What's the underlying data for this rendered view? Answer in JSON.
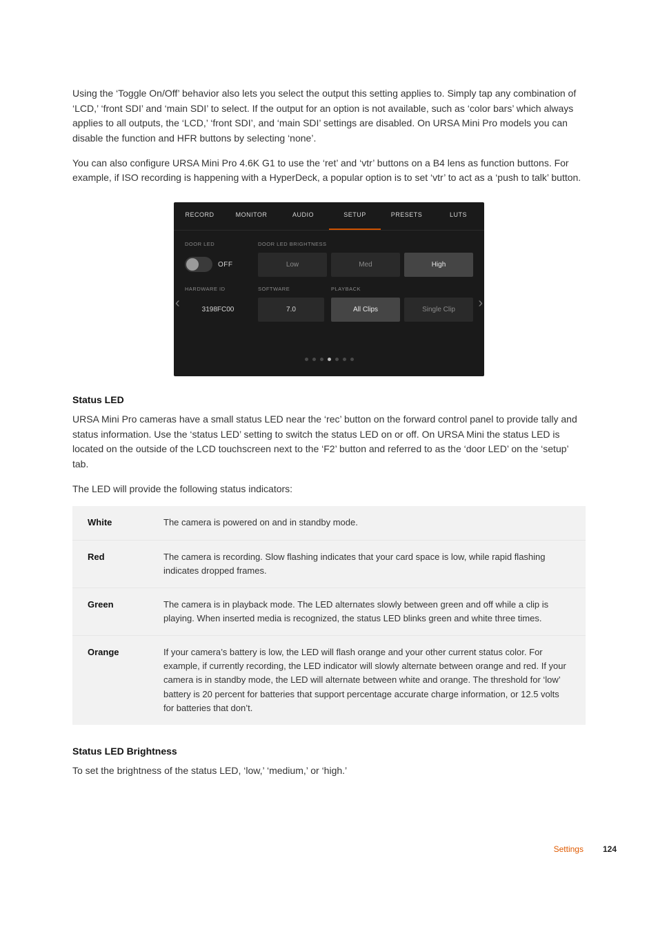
{
  "paragraphs": {
    "p1": "Using the ‘Toggle On/Off’ behavior also lets you select the output this setting applies to. Simply tap any combination of ‘LCD,’ ‘front SDI’ and ‘main SDI’ to select. If the output for an option is not available, such as ‘color bars’ which always applies to all outputs, the ‘LCD,’ ‘front SDI’, and ‘main SDI’ settings are disabled. On URSA Mini Pro models you can disable the function and HFR buttons by selecting ‘none’.",
    "p2": "You can also configure URSA Mini Pro 4.6K G1 to use the ‘ret’ and ‘vtr’ buttons on a B4 lens as function buttons. For example, if ISO recording is happening with a HyperDeck, a popular option is to set ‘vtr’ to act as a ‘push to talk’ button.",
    "p3": "URSA Mini Pro cameras have a small status LED near the ‘rec’ button on the forward control panel to provide tally and status information. Use the ‘status LED’ setting to switch the status LED on or off. On URSA Mini the status LED is located on the outside of the LCD touchscreen next to the ‘F2’ button and referred to as the ‘door LED’ on the ‘setup’ tab.",
    "p4": "The LED will provide the following status indicators:",
    "p5": "To set the brightness of the status LED, ‘low,’ ‘medium,’ or ‘high.’"
  },
  "ui": {
    "tabs": [
      "RECORD",
      "MONITOR",
      "AUDIO",
      "SETUP",
      "PRESETS",
      "LUTS"
    ],
    "active_tab": 3,
    "row1": {
      "label_left": "DOOR LED",
      "label_right": "DOOR LED BRIGHTNESS",
      "toggle": "OFF",
      "options": [
        "Low",
        "Med",
        "High"
      ],
      "selected": 2
    },
    "row2": {
      "labels": [
        "HARDWARE ID",
        "SOFTWARE",
        "PLAYBACK"
      ],
      "hw_id": "3198FC00",
      "software": "7.0",
      "options": [
        "All Clips",
        "Single Clip"
      ],
      "selected": 0
    },
    "dots_total": 7,
    "dots_active": 3
  },
  "sections": {
    "status_led": "Status LED",
    "status_led_brightness": "Status LED Brightness"
  },
  "led_rows": [
    {
      "color": "White",
      "desc": "The camera is powered on and in standby mode."
    },
    {
      "color": "Red",
      "desc": "The camera is recording. Slow flashing indicates that your card space is low, while rapid flashing indicates dropped frames."
    },
    {
      "color": "Green",
      "desc": "The camera is in playback mode. The LED alternates slowly between green and off while a clip is playing. When inserted media is recognized, the status LED blinks green and white three times."
    },
    {
      "color": "Orange",
      "desc": "If your camera’s battery is low, the LED will flash orange and your other current status color. For example, if currently recording, the LED indicator will slowly alternate between orange and red. If your camera is in standby mode, the LED will alternate between white and orange. The threshold for ‘low’ battery is 20 percent for batteries that support percentage accurate charge information, or 12.5 volts for batteries that don’t."
    }
  ],
  "footer": {
    "label": "Settings",
    "page": "124"
  }
}
